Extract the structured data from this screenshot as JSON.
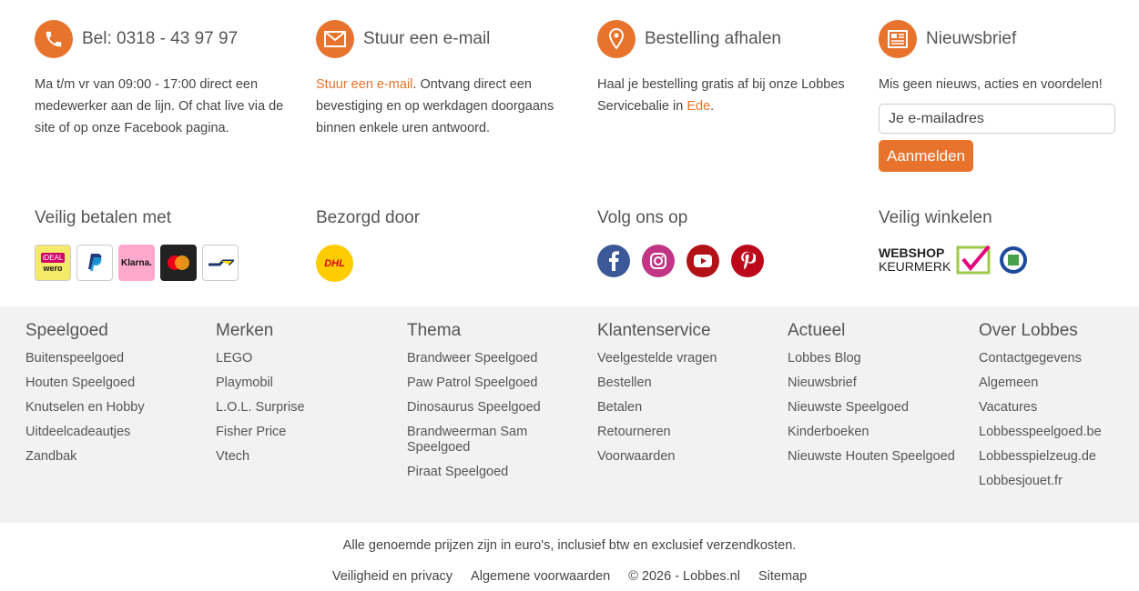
{
  "contact": {
    "phone_title": "Bel: 0318 - 43 97 97",
    "phone_text": "Ma t/m vr van 09:00 - 17:00 direct een medewerker aan de lijn. Of chat live via de site of op onze Facebook pagina.",
    "email_title": "Stuur een e-mail",
    "email_link": "Stuur een e-mail",
    "email_text": ". Ontvang direct een bevestiging en op werkdagen doorgaans binnen enkele uren antwoord.",
    "pickup_title": "Bestelling afhalen",
    "pickup_text": "Haal je bestelling gratis af bij onze Lobbes Servicebalie in ",
    "pickup_link": "Ede",
    "pickup_end": ".",
    "newsletter_title": "Nieuwsbrief",
    "newsletter_text": "Mis geen nieuws, acties en voordelen!",
    "newsletter_placeholder": "Je e-mailadres",
    "newsletter_button": "Aanmelden"
  },
  "trust": {
    "pay_title": "Veilig betalen met",
    "pay_ideal_text": "iDEAL",
    "pay_wero_text": "wero",
    "pay_klarna_text": "Klarna.",
    "delivery_title": "Bezorgd door",
    "dhl_text": "DHL",
    "social_title": "Volg ons op",
    "safe_title": "Veilig winkelen",
    "keurmerk_line1": "WEBSHOP",
    "keurmerk_line2": "KEURMERK"
  },
  "columns": [
    {
      "title": "Speelgoed",
      "items": [
        "Buitenspeelgoed",
        "Houten Speelgoed",
        "Knutselen en Hobby",
        "Uitdeelcadeautjes",
        "Zandbak"
      ]
    },
    {
      "title": "Merken",
      "items": [
        "LEGO",
        "Playmobil",
        "L.O.L. Surprise",
        "Fisher Price",
        "Vtech"
      ]
    },
    {
      "title": "Thema",
      "items": [
        "Brandweer Speelgoed",
        "Paw Patrol Speelgoed",
        "Dinosaurus Speelgoed",
        "Brandweerman Sam Speelgoed",
        "Piraat Speelgoed"
      ]
    },
    {
      "title": "Klantenservice",
      "items": [
        "Veelgestelde vragen",
        "Bestellen",
        "Betalen",
        "Retourneren",
        "Voorwaarden"
      ]
    },
    {
      "title": "Actueel",
      "items": [
        "Lobbes Blog",
        "Nieuwsbrief",
        "Nieuwste Speelgoed",
        "Kinderboeken",
        "Nieuwste Houten Speelgoed"
      ]
    },
    {
      "title": "Over Lobbes",
      "items": [
        "Contactgegevens",
        "Algemeen",
        "Vacatures",
        "Lobbesspeelgoed.be",
        "Lobbesspielzeug.de",
        "Lobbesjouet.fr"
      ]
    }
  ],
  "bottom": {
    "disclaimer": "Alle genoemde prijzen zijn in euro's, inclusief btw en exclusief verzendkosten.",
    "privacy": "Veiligheid en privacy",
    "terms": "Algemene voorwaarden",
    "copyright": "© 2026 - Lobbes.nl",
    "sitemap": "Sitemap"
  },
  "colors": {
    "accent": "#e8732c",
    "grey_bg": "#f2f2f2"
  },
  "icons": [
    "phone-icon",
    "envelope-icon",
    "map-pin-icon",
    "newsletter-icon",
    "facebook-icon",
    "instagram-icon",
    "youtube-icon",
    "pinterest-icon"
  ]
}
